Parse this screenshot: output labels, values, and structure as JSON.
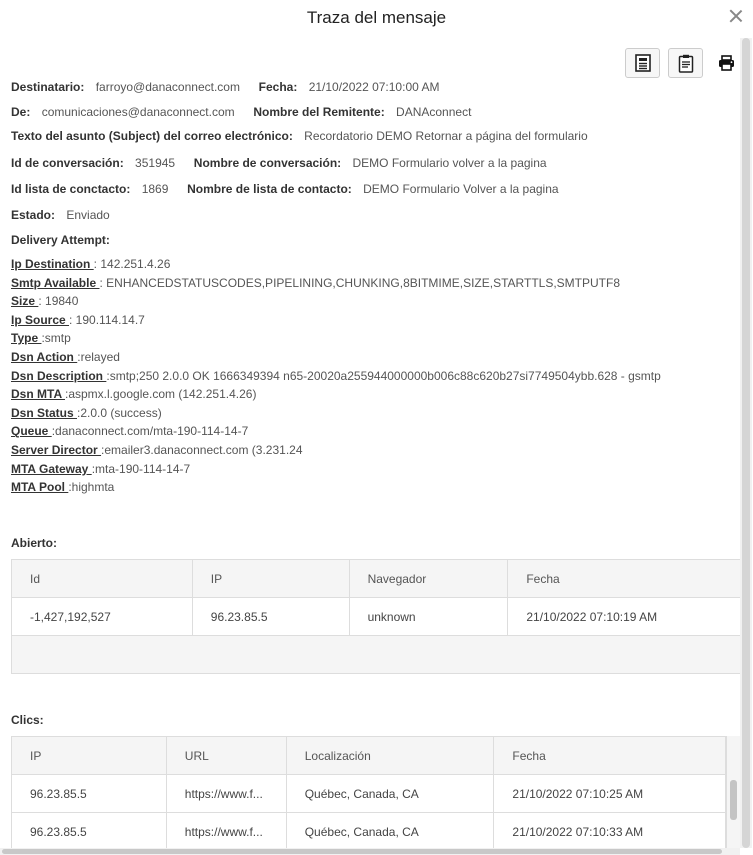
{
  "dialog": {
    "title": "Traza del mensaje"
  },
  "toolbar": {
    "icons": [
      "report-icon",
      "clipboard-icon",
      "print-icon"
    ]
  },
  "fields": {
    "destinatario_label": "Destinatario:",
    "destinatario": "farroyo@danaconnect.com",
    "fecha_label": "Fecha:",
    "fecha": "21/10/2022 07:10:00 AM",
    "de_label": "De:",
    "de": "comunicaciones@danaconnect.com",
    "remitente_label": "Nombre del Remitente:",
    "remitente": "DANAconnect",
    "asunto_label": "Texto del asunto (Subject) del correo electrónico:",
    "asunto": "Recordatorio DEMO Retornar a página del formulario",
    "id_conv_label": "Id de conversación:",
    "id_conv": "351945",
    "nombre_conv_label": "Nombre de conversación:",
    "nombre_conv": "DEMO Formulario volver a la pagina",
    "id_lista_label": "Id lista de conctacto:",
    "id_lista": "1869",
    "nombre_lista_label": "Nombre de lista de contacto:",
    "nombre_lista": "DEMO Formulario Volver a la pagina",
    "estado_label": "Estado:",
    "estado": "Enviado",
    "delivery_label": "Delivery Attempt:"
  },
  "delivery": [
    {
      "k": "Ip Destination ",
      "v": ": 142.251.4.26"
    },
    {
      "k": "Smtp Available ",
      "v": ": ENHANCEDSTATUSCODES,PIPELINING,CHUNKING,8BITMIME,SIZE,STARTTLS,SMTPUTF8"
    },
    {
      "k": "Size ",
      "v": ": 19840"
    },
    {
      "k": "Ip Source ",
      "v": ": 190.114.14.7"
    },
    {
      "k": "Type ",
      "v": ":smtp"
    },
    {
      "k": "Dsn Action ",
      "v": ":relayed"
    },
    {
      "k": "Dsn Description ",
      "v": ":smtp;250 2.0.0 OK 1666349394 n65-20020a255944000000b006c88c620b27si7749504ybb.628 - gsmtp"
    },
    {
      "k": "Dsn MTA ",
      "v": ":aspmx.l.google.com (142.251.4.26)"
    },
    {
      "k": "Dsn Status ",
      "v": ":2.0.0 (success)"
    },
    {
      "k": "Queue ",
      "v": ":danaconnect.com/mta-190-114-14-7"
    },
    {
      "k": "Server Director ",
      "v": ":emailer3.danaconnect.com (3.231.24"
    },
    {
      "k": "MTA Gateway ",
      "v": ":mta-190-114-14-7"
    },
    {
      "k": "MTA Pool ",
      "v": ":highmta"
    }
  ],
  "abierto": {
    "label": "Abierto:",
    "headers": [
      "Id",
      "IP",
      "Navegador",
      "Fecha"
    ],
    "rows": [
      [
        "-1,427,192,527",
        "96.23.85.5",
        "unknown",
        "21/10/2022 07:10:19 AM"
      ]
    ]
  },
  "clics": {
    "label": "Clics:",
    "headers": [
      "IP",
      "URL",
      "Localización",
      "Fecha"
    ],
    "rows": [
      [
        "96.23.85.5",
        "https://www.f...",
        "Québec, Canada, CA",
        "21/10/2022 07:10:25 AM"
      ],
      [
        "96.23.85.5",
        "https://www.f...",
        "Québec, Canada, CA",
        "21/10/2022 07:10:33 AM"
      ]
    ]
  }
}
